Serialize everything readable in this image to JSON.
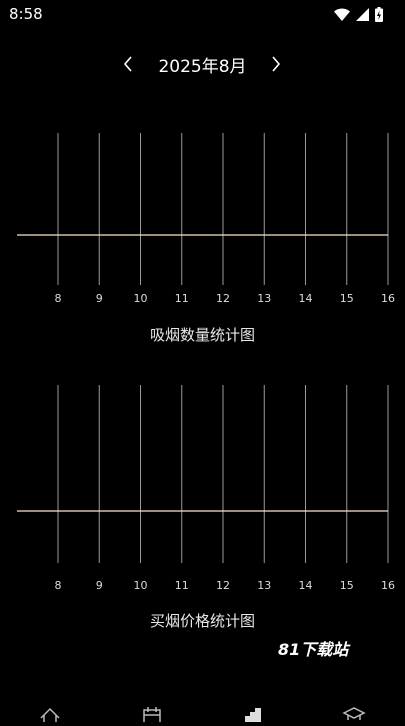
{
  "status": {
    "time": "8:58"
  },
  "nav": {
    "month": "2025年8月",
    "prev_icon": "chevron-left-icon",
    "next_icon": "chevron-right-icon"
  },
  "charts": [
    {
      "title": "吸烟数量统计图"
    },
    {
      "title": "买烟价格统计图"
    }
  ],
  "chart_data": [
    {
      "type": "line",
      "title": "吸烟数量统计图",
      "x": [
        8,
        9,
        10,
        11,
        12,
        13,
        14,
        15,
        16
      ],
      "series": [
        {
          "values": [
            0,
            0,
            0,
            0,
            0,
            0,
            0,
            0,
            0
          ]
        }
      ],
      "grid": true,
      "line_color": "#f5e6c8"
    },
    {
      "type": "line",
      "title": "买烟价格统计图",
      "x": [
        8,
        9,
        10,
        11,
        12,
        13,
        14,
        15,
        16
      ],
      "series": [
        {
          "values": [
            0,
            0,
            0,
            0,
            0,
            0,
            0,
            0,
            0
          ]
        }
      ],
      "grid": true,
      "line_color": "#f5e6c8"
    }
  ],
  "watermark": "81下载站",
  "bottom_nav": [
    {
      "icon": "home-icon"
    },
    {
      "icon": "calendar-icon"
    },
    {
      "icon": "chart-icon"
    },
    {
      "icon": "graduation-cap-icon"
    }
  ]
}
